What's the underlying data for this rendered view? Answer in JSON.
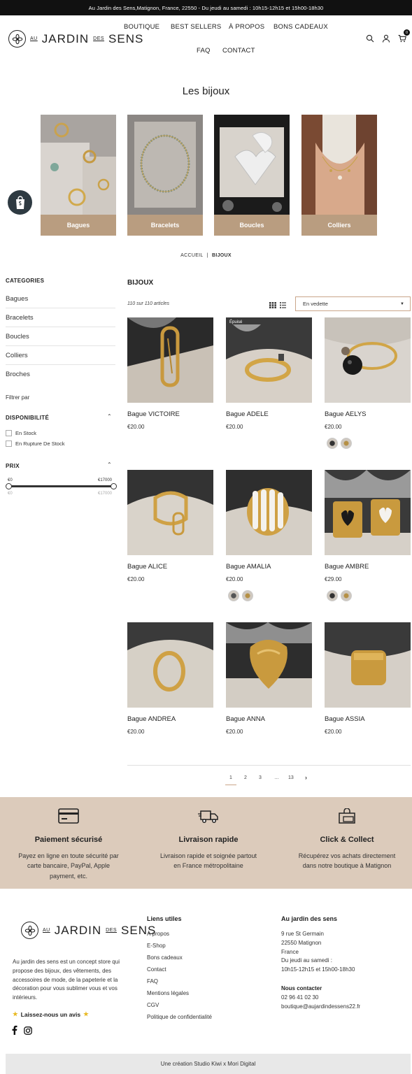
{
  "announcement": "Au Jardin des Sens,Matignon, France, 22550 - Du jeudi au samedi : 10h15-12h15 et 15h00-18h30",
  "logo": {
    "au": "AU",
    "main1": "JARDIN",
    "des": "DES",
    "main2": "SENS"
  },
  "nav": [
    "BOUTIQUE",
    "BEST SELLERS",
    "À PROPOS",
    "BONS CADEAUX",
    "FAQ",
    "CONTACT"
  ],
  "cart_count": "0",
  "page_title": "Les bijoux",
  "collections": [
    "Bagues",
    "Bracelets",
    "Boucles",
    "Colliers"
  ],
  "breadcrumb": {
    "home": "ACCUEIL",
    "sep": "|",
    "current": "BIJOUX"
  },
  "sidebar": {
    "categories_title": "CATEGORIES",
    "categories": [
      "Bagues",
      "Bracelets",
      "Boucles",
      "Colliers",
      "Broches"
    ],
    "filter_by": "Filtrer par",
    "availability_title": "DISPONIBILITÉ",
    "availability": [
      "En Stock",
      "En Rupture De Stock"
    ],
    "price_title": "PRIX",
    "price_min": "€0",
    "price_max": "€17000",
    "price_min_input": "€0",
    "price_max_input": "€17000"
  },
  "products_section": {
    "title": "BIJOUX",
    "count": "110 sur 110 articles",
    "sort_value": "En vedette"
  },
  "products": [
    {
      "name": "Bague VICTOIRE",
      "price": "€20.00",
      "badge": "",
      "swatches": 0
    },
    {
      "name": "Bague ADELE",
      "price": "€20.00",
      "badge": "Épuisé",
      "swatches": 0
    },
    {
      "name": "Bague AELYS",
      "price": "€20.00",
      "badge": "",
      "swatches": 2
    },
    {
      "name": "Bague ALICE",
      "price": "€20.00",
      "badge": "",
      "swatches": 0
    },
    {
      "name": "Bague AMALIA",
      "price": "€20.00",
      "badge": "",
      "swatches": 2
    },
    {
      "name": "Bague AMBRE",
      "price": "€29.00",
      "badge": "",
      "swatches": 2
    },
    {
      "name": "Bague ANDREA",
      "price": "€20.00",
      "badge": "",
      "swatches": 0
    },
    {
      "name": "Bague ANNA",
      "price": "€20.00",
      "badge": "",
      "swatches": 0
    },
    {
      "name": "Bague ASSIA",
      "price": "€20.00",
      "badge": "",
      "swatches": 0
    }
  ],
  "pagination": {
    "pages": [
      "1",
      "2",
      "3",
      "…",
      "13"
    ],
    "current": "1",
    "next": "›"
  },
  "features": [
    {
      "title": "Paiement sécurisé",
      "line1": "Payez en ligne en toute sécurité par",
      "line2": "carte bancaire, PayPal, Apple",
      "line3": "payment, etc.",
      "icon": "credit-card-icon"
    },
    {
      "title": "Livraison rapide",
      "line1": "Livraison rapide et soignée partout",
      "line2": "en France métropolitaine",
      "line3": "",
      "icon": "delivery-truck-icon"
    },
    {
      "title": "Click & Collect",
      "line1": "Récupérez vos achats directement",
      "line2": "dans notre boutique à Matignon",
      "line3": "",
      "icon": "shopping-bag-icon"
    }
  ],
  "footer": {
    "about_lines": [
      "Au jardin des sens est un concept store qui",
      "propose des bijoux, des vêtements, des",
      "accessoires de mode, de la papeterie et la",
      "décoration pour vous sublimer vous et vos",
      "intérieurs."
    ],
    "review": "Laissez-nous un avis",
    "links_title": "Liens utiles",
    "links": [
      "À propos",
      "E-Shop",
      "Bons cadeaux",
      "Contact",
      "FAQ",
      "Mentions légales",
      "CGV",
      "Politique de confidentialité"
    ],
    "store_title": "Au jardin des sens",
    "store_lines": [
      "9 rue St Germain",
      "22550 Matignon",
      "France",
      "Du jeudi au samedi :",
      "10h15-12h15 et 15h00-18h30"
    ],
    "contact_title": "Nous contacter",
    "phone": "02 96 41 02 30",
    "email": "boutique@aujardindessens22.fr",
    "copyright": "Une création Studio Kiwi x Mori Digital"
  }
}
